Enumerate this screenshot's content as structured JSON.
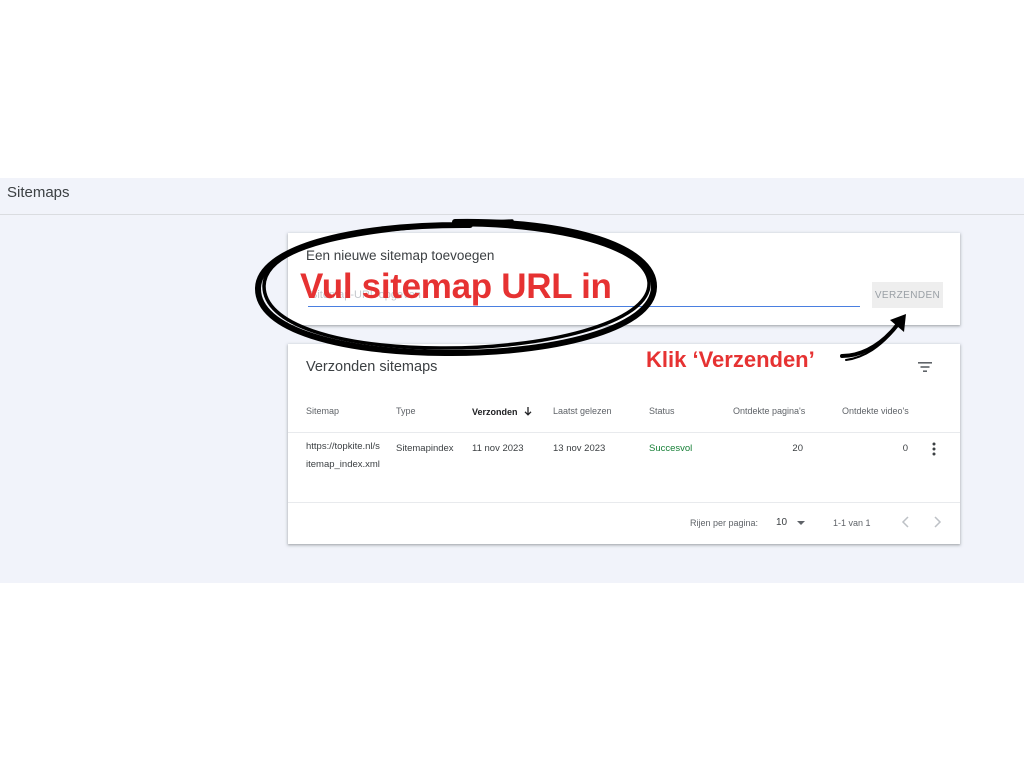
{
  "page": {
    "title": "Sitemaps"
  },
  "add_card": {
    "title": "Een nieuwe sitemap toevoegen",
    "input_placeholder": "Sitemap-URL opgeven",
    "input_value": "",
    "submit_label": "VERZENDEN"
  },
  "list_card": {
    "title": "Verzonden sitemaps",
    "columns": [
      "Sitemap",
      "Type",
      "Verzonden",
      "Laatst gelezen",
      "Status",
      "Ontdekte pagina's",
      "Ontdekte video's"
    ],
    "sorted_column": "Verzonden",
    "rows": [
      {
        "sitemap": "https://topkite.nl/sitemap_index.xml",
        "type": "Sitemapindex",
        "submitted": "11 nov 2023",
        "last_read": "13 nov 2023",
        "status": "Succesvol",
        "pages": "20",
        "videos": "0"
      }
    ],
    "footer": {
      "rows_per_page_label": "Rijen per pagina:",
      "rows_per_page_value": "10",
      "range": "1-1 van 1"
    }
  },
  "annotations": {
    "oval_text": "Vul sitemap URL in",
    "arrow_text": "Klik ‘Verzenden’",
    "color": "#e63232"
  },
  "colors": {
    "background": "#f1f3fa",
    "input_underline": "#4a7fe0",
    "success": "#188038"
  },
  "icons": [
    "filter-icon",
    "sort-arrow-down-icon",
    "more-vert-icon",
    "chevron-down-icon",
    "chevron-left-icon",
    "chevron-right-icon"
  ]
}
